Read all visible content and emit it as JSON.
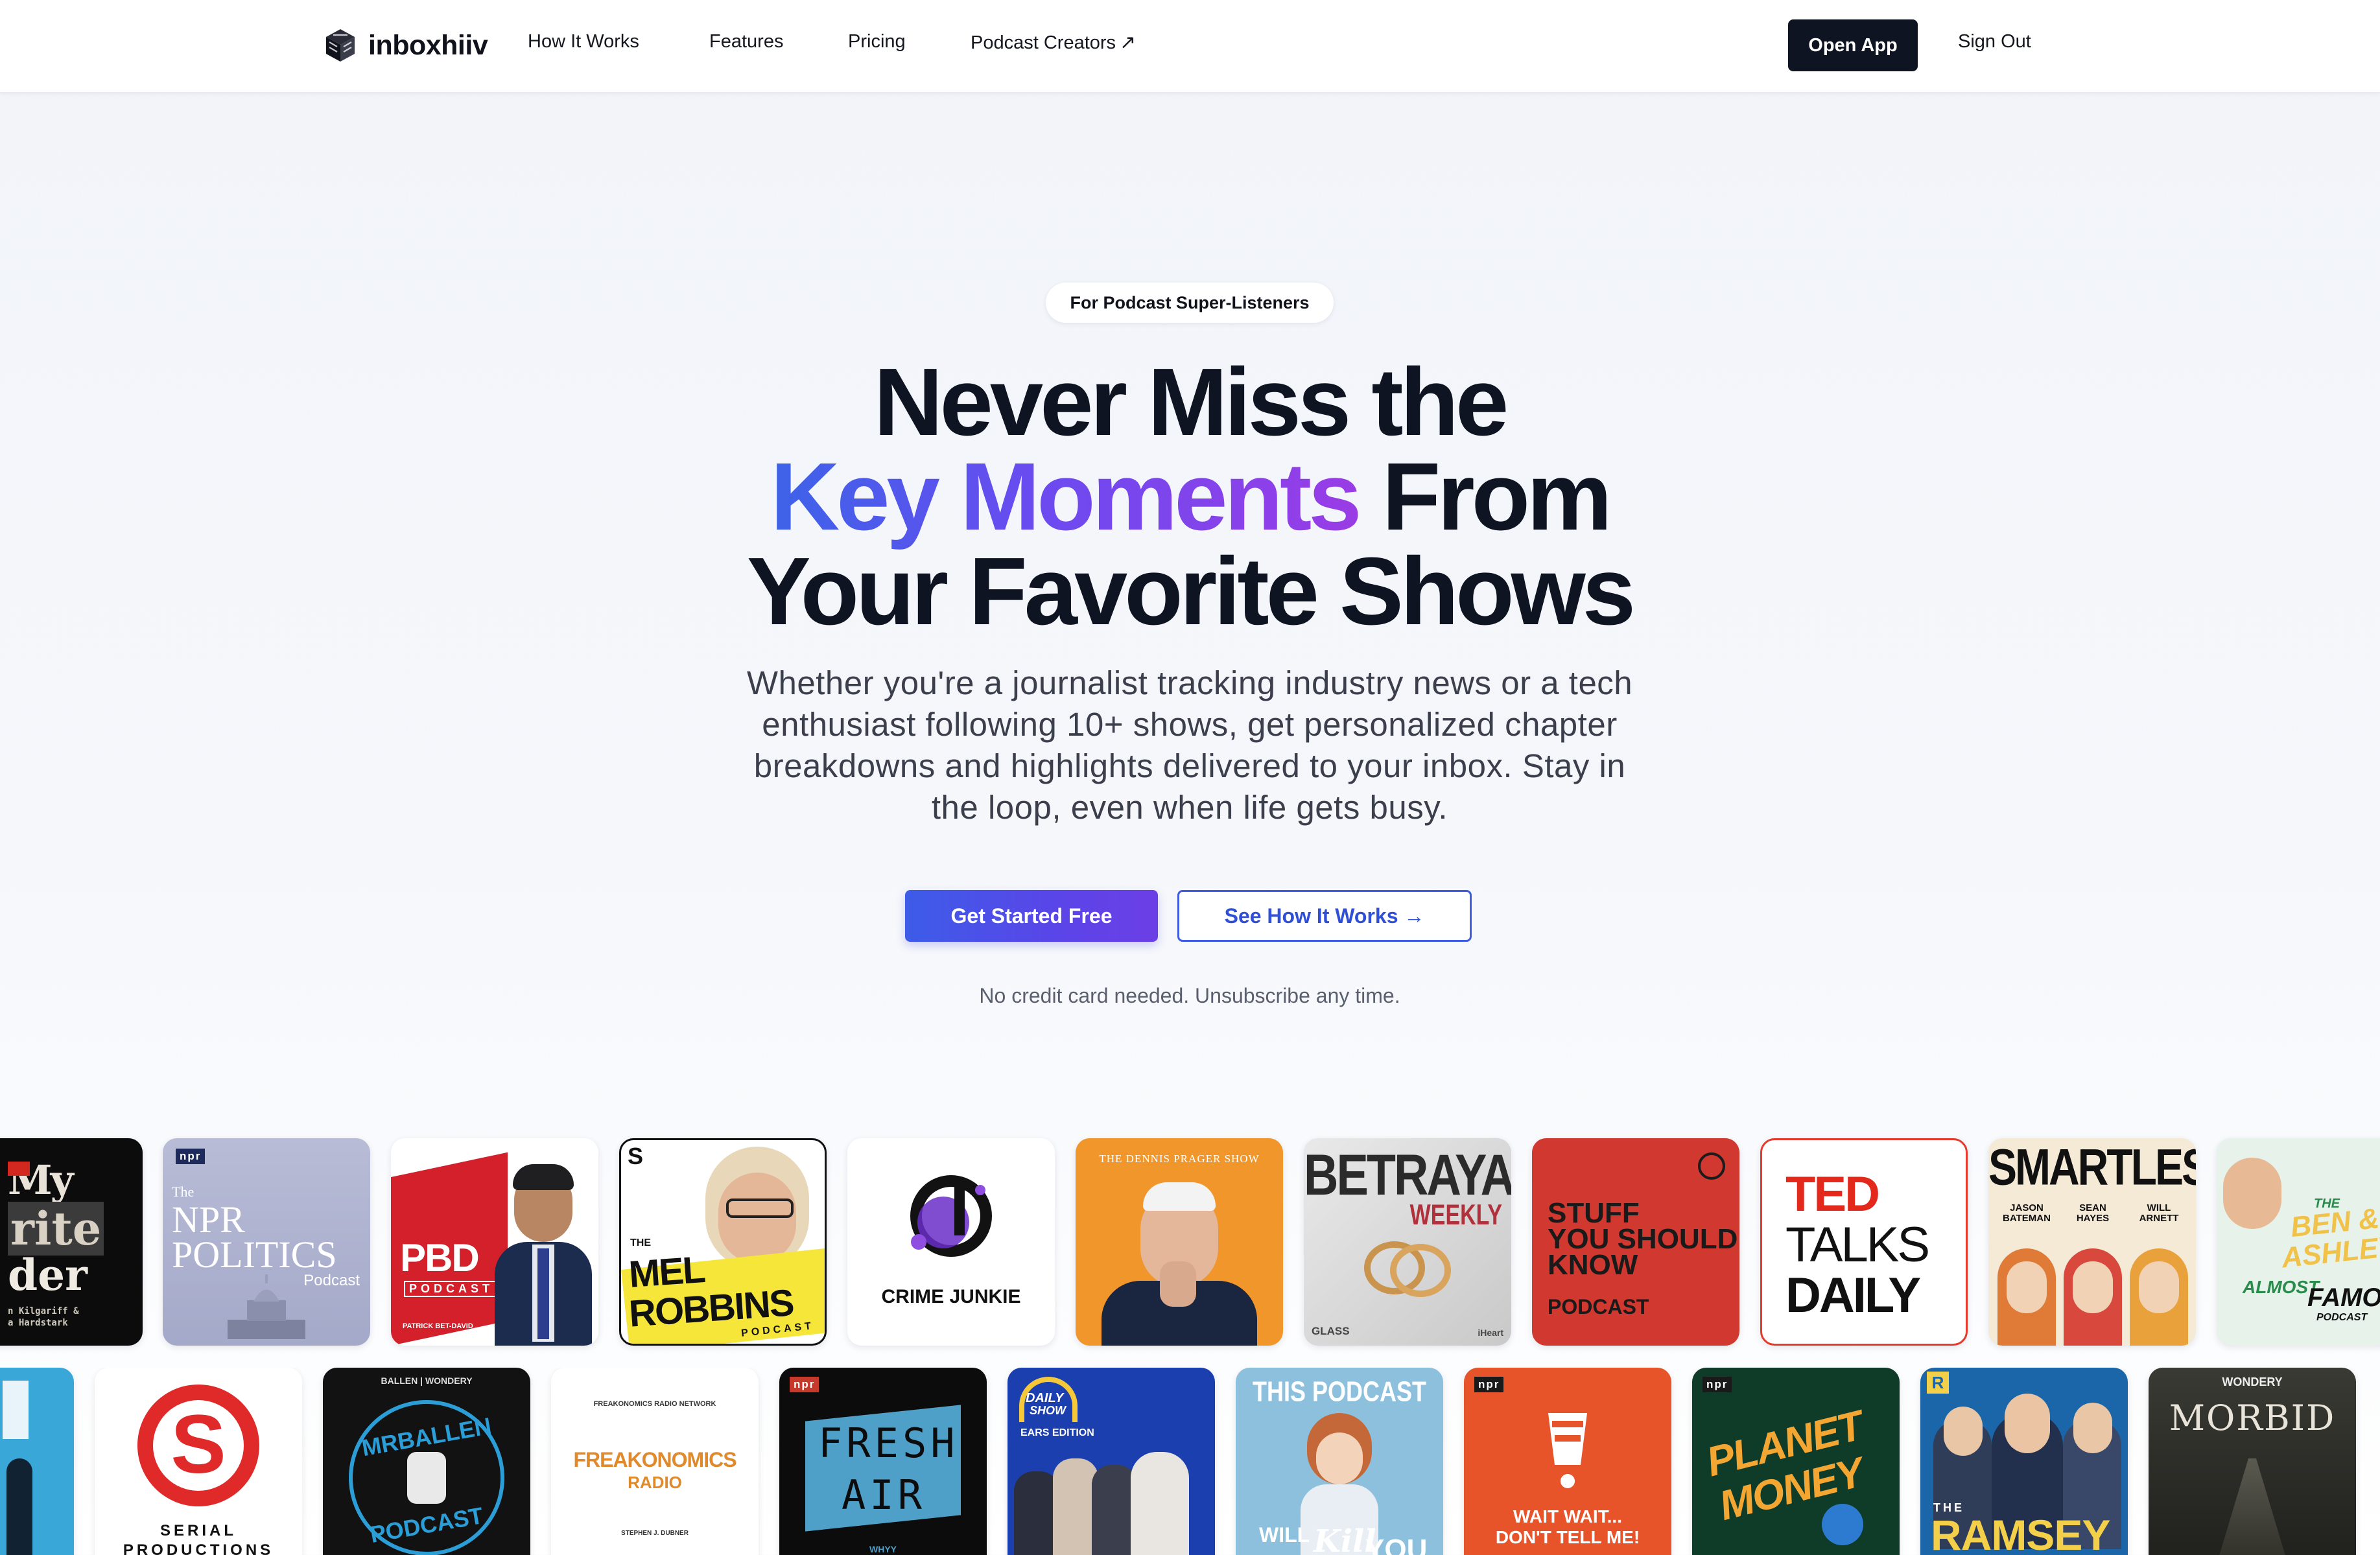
{
  "nav": {
    "brand": "inboxhiiv",
    "links": [
      "How It Works",
      "Features",
      "Pricing",
      "Podcast Creators"
    ],
    "open_app": "Open App",
    "sign_out": "Sign Out"
  },
  "hero": {
    "pill": "For Podcast Super-Listeners",
    "headline_line1": "Never Miss the",
    "headline_gradient": "Key Moments",
    "headline_line2_rest": " From",
    "headline_line3": "Your Favorite Shows",
    "subcopy": "Whether you're a journalist tracking industry news or a tech enthusiast following 10+ shows, get personalized chapter breakdowns and highlights delivered to your inbox. Stay in the loop, even when life gets busy.",
    "cta_primary": "Get Started Free",
    "cta_secondary": "See How It Works →",
    "fineprint": "No credit card needed. Unsubscribe any time."
  },
  "podcasts": {
    "row1": {
      "my_favorite_murder": {
        "line1": "My",
        "line2": "rite",
        "line3": "der",
        "hosts": "n Kilgariff & a Hardstark"
      },
      "npr_politics": {
        "badge": "npr",
        "the": "The",
        "line1": "NPR",
        "line2": "POLITICS",
        "sub": "Podcast"
      },
      "pbd": {
        "title": "PBD",
        "sub": "PODCAST",
        "host": "PATRICK BET-DAVID"
      },
      "mel_robbins": {
        "the": "THE",
        "line1": "MEL",
        "line2": "ROBBINS",
        "sub": "PODCAST",
        "s": "S"
      },
      "crime_junkie": {
        "title": "CRIME JUNKIE"
      },
      "dennis_prager": {
        "title": "THE DENNIS PRAGER SHOW"
      },
      "betrayal": {
        "title": "BETRAYAL",
        "sub": "WEEKLY",
        "glass": "GLASS",
        "iheart": "iHeart"
      },
      "stuff_you_should_know": {
        "line1": "STUFF",
        "line2": "YOU SHOULD",
        "line3": "KNOW",
        "line4": "PODCAST"
      },
      "ted_talks_daily": {
        "line1": "TED",
        "line2": "TALKS",
        "line3": "DAILY"
      },
      "smartless": {
        "title": "SMARTLESS",
        "h1": "JASON BATEMAN",
        "h2": "SEAN HAYES",
        "h3": "WILL ARNETT"
      },
      "ben_ashley": {
        "the": "THE",
        "line1": "BEN &",
        "line2": "ASHLEY I",
        "line3": "ALMOST",
        "line4": "FAMO",
        "line5": "PODCAST"
      }
    },
    "row2": {
      "serial": {
        "letter": "S",
        "line1": "SERIAL",
        "line2": "PRODUCTIONS"
      },
      "mrballen": {
        "top": "BALLEN | WONDERY",
        "line1": "MRBALLEN",
        "line2": "PODCAST"
      },
      "freakonomics": {
        "top": "FREAKONOMICS RADIO NETWORK",
        "title": "FREAKONOMICS",
        "sub": "RADIO",
        "host": "STEPHEN J. DUBNER"
      },
      "fresh_air": {
        "badge": "npr",
        "line1": "FRESH",
        "line2": "AIR",
        "sub": "WHYY"
      },
      "daily_show": {
        "line1": "DAILY",
        "line2": "SHOW",
        "sub": "EARS EDITION"
      },
      "this_podcast": {
        "line1": "THIS PODCAST",
        "line2": "WILL",
        "line3": "Kill",
        "line4": "YOU"
      },
      "wait_wait": {
        "badge": "npr",
        "line1": "WAIT WAIT...",
        "line2": "DON'T TELL ME!"
      },
      "planet_money": {
        "badge": "npr",
        "line1": "PLANET",
        "line2": "MONEY"
      },
      "ramsey": {
        "the": "THE",
        "title": "RAMSEY",
        "r": "R"
      },
      "morbid": {
        "top": "WONDERY",
        "title": "MORBID"
      }
    }
  },
  "colors": {
    "brand_dark": "#0e1422",
    "accent_blue": "#3d5ce8",
    "accent_purple": "#6b3fe6"
  }
}
